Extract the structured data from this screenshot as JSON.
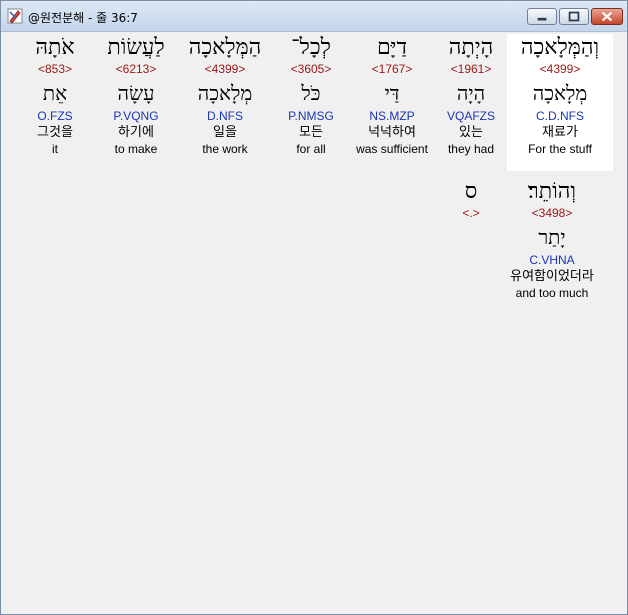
{
  "window": {
    "title": "@원전분해 - 줄 36:7",
    "buttons": {
      "minimize": "minimize-icon",
      "maximize": "maximize-icon",
      "close": "close-icon"
    }
  },
  "words": [
    {
      "hebrew": "וְהַמְּלָאכָה",
      "strong": "<4399>",
      "root": "מְלָאכָה",
      "morph": "C.D.NFS",
      "korean": "재료가",
      "english": "For the stuff"
    },
    {
      "hebrew": "הָיְתָה",
      "strong": "<1961>",
      "root": "הָיָה",
      "morph": "VQAFZS",
      "korean": "있는",
      "english": "they had"
    },
    {
      "hebrew": "דַיָּם",
      "strong": "<1767>",
      "root": "דַּי",
      "morph": "NS.MZP",
      "korean": "넉넉하여",
      "english": "was sufficient"
    },
    {
      "hebrew": "לְכָל־",
      "strong": "<3605>",
      "root": "כֹּל",
      "morph": "P.NMSG",
      "korean": "모든",
      "english": "for all"
    },
    {
      "hebrew": "הַמְּלָאכָה",
      "strong": "<4399>",
      "root": "מְלָאכָה",
      "morph": "D.NFS",
      "korean": "일을",
      "english": "the work"
    },
    {
      "hebrew": "לַעֲשׂוֹת",
      "strong": "<6213>",
      "root": "עָשָׂה",
      "morph": "P.VQNG",
      "korean": "하기에",
      "english": "to make"
    },
    {
      "hebrew": "אֹתָהּ",
      "strong": "<853>",
      "root": "אֵת",
      "morph": "O.FZS",
      "korean": "그것을",
      "english": "it"
    },
    {
      "hebrew": "וְהוֹתֵר׃",
      "strong": "<3498>",
      "root": "יָתַר",
      "morph": "C.VHNA",
      "korean": "유여함이었더라",
      "english": "and too much"
    },
    {
      "hebrew": "ס",
      "strong": "<.>",
      "root": "",
      "morph": "",
      "korean": "",
      "english": ""
    }
  ]
}
